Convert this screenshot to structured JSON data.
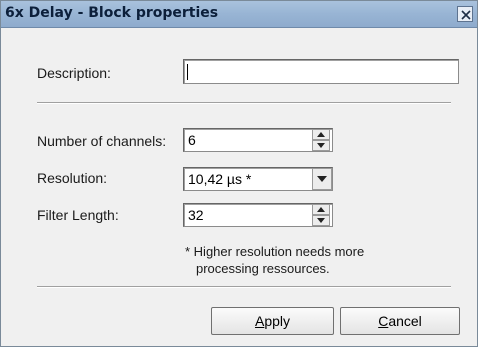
{
  "window": {
    "title": "6x Delay - Block properties"
  },
  "description": {
    "label": "Description:",
    "value": ""
  },
  "channels": {
    "label": "Number of channels:",
    "value": "6"
  },
  "resolution": {
    "label": "Resolution:",
    "value": "10,42 µs *"
  },
  "filter_length": {
    "label": "Filter Length:",
    "value": "32"
  },
  "note": {
    "line1": "* Higher resolution needs more",
    "line2": "processing ressources."
  },
  "buttons": {
    "apply_accel": "A",
    "apply_rest": "pply",
    "cancel_accel": "C",
    "cancel_rest": "ancel"
  },
  "icons": {
    "close": "close-icon",
    "up": "spin-up-arrow-icon",
    "down": "spin-down-arrow-icon",
    "dropdown": "chevron-down-icon"
  }
}
